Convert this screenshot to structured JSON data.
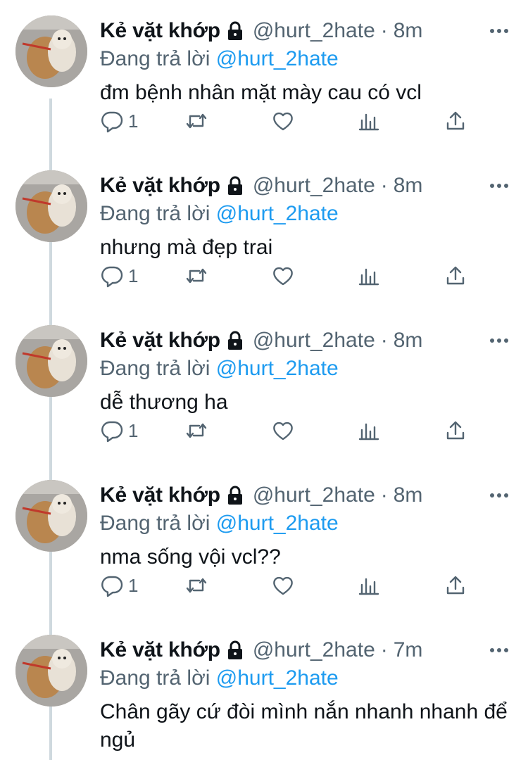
{
  "tweets": [
    {
      "name": "Kẻ vặt khớp",
      "handle": "@hurt_2hate",
      "separator": "·",
      "time": "8m",
      "reply_prefix": "Đang trả lời",
      "reply_to": "@hurt_2hate",
      "text": "đm bệnh nhân mặt mày cau có vcl",
      "reply_count": "1"
    },
    {
      "name": "Kẻ vặt khớp",
      "handle": "@hurt_2hate",
      "separator": "·",
      "time": "8m",
      "reply_prefix": "Đang trả lời",
      "reply_to": "@hurt_2hate",
      "text": "nhưng mà đẹp trai",
      "reply_count": "1"
    },
    {
      "name": "Kẻ vặt khớp",
      "handle": "@hurt_2hate",
      "separator": "·",
      "time": "8m",
      "reply_prefix": "Đang trả lời",
      "reply_to": "@hurt_2hate",
      "text": "dễ thương ha",
      "reply_count": "1"
    },
    {
      "name": "Kẻ vặt khớp",
      "handle": "@hurt_2hate",
      "separator": "·",
      "time": "8m",
      "reply_prefix": "Đang trả lời",
      "reply_to": "@hurt_2hate",
      "text": "nma sống vội vcl??",
      "reply_count": "1"
    },
    {
      "name": "Kẻ vặt khớp",
      "handle": "@hurt_2hate",
      "separator": "·",
      "time": "7m",
      "reply_prefix": "Đang trả lời",
      "reply_to": "@hurt_2hate",
      "text": "Chân gãy cứ đòi mình nắn nhanh nhanh để ngủ",
      "reply_count": ""
    }
  ],
  "icons": {
    "lock": "lock-icon",
    "more": "more-icon",
    "reply": "reply-icon",
    "retweet": "retweet-icon",
    "like": "heart-icon",
    "views": "analytics-icon",
    "share": "share-icon"
  },
  "colors": {
    "mention": "#1d9bf0",
    "secondary": "#536471",
    "text": "#0f1419",
    "thread_line": "#cfd9de"
  }
}
